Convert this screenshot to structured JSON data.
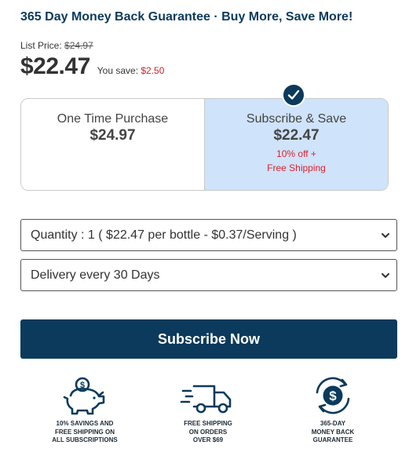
{
  "headline": "365 Day Money Back Guarantee · Buy More, Save More!",
  "pricing": {
    "list_label": "List Price:",
    "list_value": "$24.97",
    "current": "$22.47",
    "save_label": "You save:",
    "save_value": "$2.50"
  },
  "options": {
    "one_time": {
      "title": "One Time Purchase",
      "price": "$24.97"
    },
    "subscribe": {
      "title": "Subscribe & Save",
      "price": "$22.47",
      "note_1": "10% off +",
      "note_2": "Free Shipping",
      "selected": true
    }
  },
  "selects": {
    "quantity": "Quantity : 1 ( $22.47 per bottle - $0.37/Serving )",
    "delivery": "Delivery every 30 Days"
  },
  "cta": {
    "label": "Subscribe Now"
  },
  "features": [
    {
      "icon": "piggy-bank-icon",
      "line1": "10% SAVINGS AND",
      "line2": "FREE SHIPPING ON",
      "line3": "ALL SUBSCRIPTIONS"
    },
    {
      "icon": "delivery-truck-icon",
      "line1": "FREE SHIPPING",
      "line2": "ON ORDERS",
      "line3": "OVER $69"
    },
    {
      "icon": "money-back-icon",
      "line1": "365-DAY",
      "line2": "MONEY BACK",
      "line3": "GUARANTEE"
    }
  ],
  "colors": {
    "brand_navy": "#0b3a5c",
    "selected_bg": "#cfe3fb",
    "accent_red": "#e0202c"
  }
}
